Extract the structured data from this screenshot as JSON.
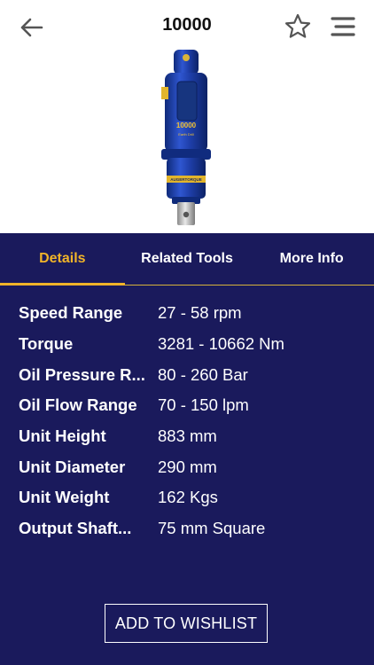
{
  "header": {
    "title": "10000",
    "back_icon": "arrow-left-icon",
    "favorite_icon": "star-outline-icon",
    "menu_icon": "menu-icon"
  },
  "product": {
    "model_label": "10000",
    "sub_label": "Earth Drill",
    "brand_label": "AUGERTORQUE"
  },
  "tabs": [
    {
      "label": "Details",
      "active": true
    },
    {
      "label": "Related Tools",
      "active": false
    },
    {
      "label": "More Info",
      "active": false
    }
  ],
  "specs": [
    {
      "label": "Speed Range",
      "value": "27 - 58 rpm"
    },
    {
      "label": "Torque",
      "value": "3281 - 10662 Nm"
    },
    {
      "label": "Oil Pressure R...",
      "value": "80 - 260 Bar"
    },
    {
      "label": "Oil Flow Range",
      "value": "70 - 150 lpm"
    },
    {
      "label": "Unit Height",
      "value": "883 mm"
    },
    {
      "label": "Unit Diameter",
      "value": "290 mm"
    },
    {
      "label": "Unit Weight",
      "value": "162 Kgs"
    },
    {
      "label": "Output Shaft...",
      "value": "75 mm Square"
    }
  ],
  "actions": {
    "wishlist_label": "ADD TO WISHLIST"
  },
  "colors": {
    "background": "#1a1a5c",
    "accent": "#f0b429",
    "header_bg": "#ffffff",
    "product_blue": "#1e3ea8"
  }
}
